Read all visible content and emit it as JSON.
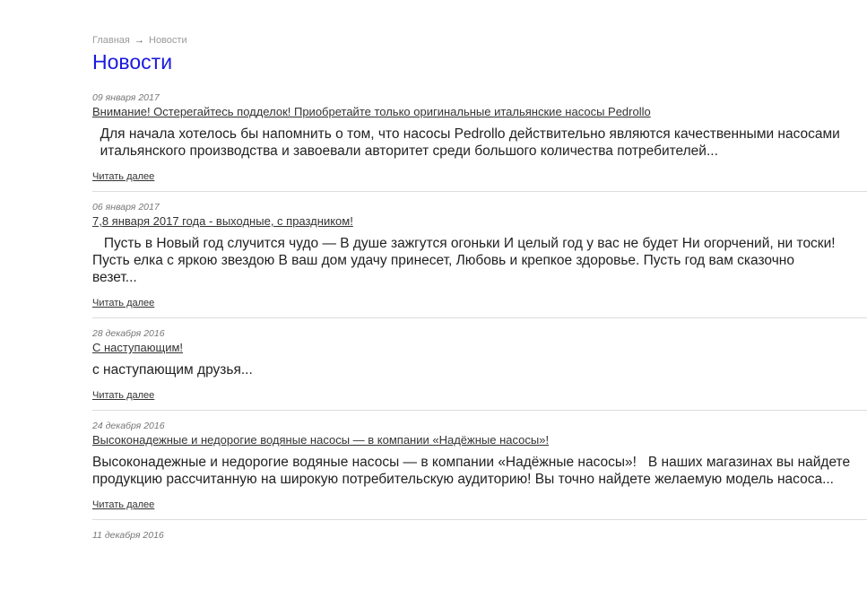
{
  "breadcrumb": {
    "home": "Главная",
    "separator": "→",
    "current": "Новости"
  },
  "page_title": "Новости",
  "read_more_label": "Читать далее",
  "news": [
    {
      "date": "09 января 2017",
      "title": "Внимание! Остерегайтесь подделок! Приобретайте только оригинальные итальянские насосы Pedrollo",
      "lines": [
        "  Для начала хотелось бы напомнить о том, что насосы Pedrollo действительно являются качественными насосами",
        "  итальянского производства и завоевали авторитет среди большого количества потребителей..."
      ],
      "read_more": "Читать далее"
    },
    {
      "date": "06 января 2017",
      "title": "7,8 января 2017 года - выходные, с праздником!",
      "lines": [
        "   Пусть в Новый год случится чудо — В душе зажгутся огоньки И целый год у вас не будет Ни огорчений, ни тоски!",
        "Пусть елка с яркою звездою В ваш дом удачу принесет, Любовь и крепкое здоровье. Пусть год вам сказочно",
        "везет..."
      ],
      "read_more": "Читать далее"
    },
    {
      "date": "28 декабря 2016",
      "title": "С наступающим!",
      "lines": [
        "с наступающим друзья..."
      ],
      "read_more": "Читать далее"
    },
    {
      "date": "24 декабря 2016",
      "title": "Высоконадежные и недорогие водяные насосы — в компании «Надёжные насосы»!",
      "lines": [
        "Высоконадежные и недорогие водяные насосы — в компании «Надёжные насосы»!   В наших магазинах вы найдете",
        "продукцию рассчитанную на широкую потребительскую аудиторию! Вы точно найдете желаемую модель насоса..."
      ],
      "read_more": "Читать далее"
    },
    {
      "date": "11 декабря 2016",
      "title": "",
      "lines": [],
      "read_more": ""
    }
  ],
  "colors": {
    "title": "#1a1adf",
    "text": "#222222",
    "muted": "#9a9a9a",
    "divider": "#dcdcdc"
  }
}
